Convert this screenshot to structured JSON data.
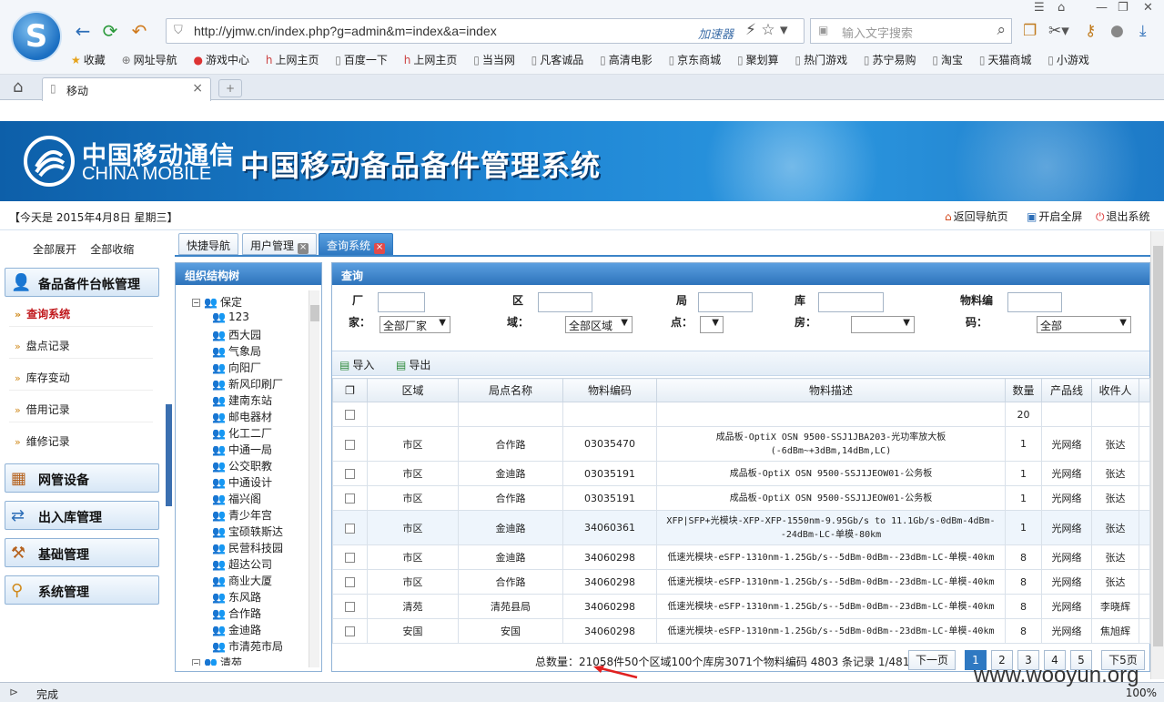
{
  "browser": {
    "url": "http://yjmw.cn/index.php?g=admin&m=index&a=index",
    "accelerator_label": "加速器",
    "search_placeholder": "输入文字搜索",
    "tab_title": "移动",
    "new_tab": "+",
    "status": "完成",
    "zoom": "100%",
    "bookmarks": [
      "收藏",
      "网址导航",
      "游戏中心",
      "上网主页",
      "百度一下",
      "上网主页",
      "当当网",
      "凡客诚品",
      "高清电影",
      "京东商城",
      "聚划算",
      "热门游戏",
      "苏宁易购",
      "淘宝",
      "天猫商城",
      "小游戏"
    ]
  },
  "header": {
    "company_cn": "中国移动通信",
    "company_en": "CHINA MOBILE",
    "system_title": "中国移动备品备件管理系统",
    "date_text": "【今天是 2015年4月8日 星期三】",
    "links": [
      "返回导航页",
      "开启全屏",
      "退出系统"
    ]
  },
  "left_menu": {
    "expand_all": "全部展开",
    "collapse_all": "全部收缩",
    "sections": [
      {
        "label": "备品备件台帐管理",
        "items": [
          {
            "label": "查询系统",
            "active": true
          },
          {
            "label": "盘点记录",
            "active": false
          },
          {
            "label": "库存变动",
            "active": false
          },
          {
            "label": "借用记录",
            "active": false
          },
          {
            "label": "维修记录",
            "active": false
          }
        ]
      },
      {
        "label": "网管设备",
        "items": []
      },
      {
        "label": "出入库管理",
        "items": []
      },
      {
        "label": "基础管理",
        "items": []
      },
      {
        "label": "系统管理",
        "items": []
      }
    ]
  },
  "tabs": [
    "快捷导航",
    "用户管理",
    "查询系统"
  ],
  "org_panel": {
    "title": "组织结构树",
    "root": "保定",
    "children": [
      "123",
      "西大园",
      "气象局",
      "向阳厂",
      "新风印刷厂",
      "建南东站",
      "邮电器材",
      "化工二厂",
      "中通一局",
      "公交职教",
      "中通设计",
      "福兴阁",
      "青少年宫",
      "宝硕轶斯达",
      "民营科技园",
      "超达公司",
      "商业大厦",
      "东风路",
      "合作路",
      "金迪路",
      "市清苑市局"
    ],
    "next_root": "清苑"
  },
  "query": {
    "title": "查询",
    "fields": {
      "factory_label_top": "厂",
      "factory_label_bottom": "家：",
      "factory_value": "全部厂家",
      "region_label_top": "区",
      "region_label_bottom": "域：",
      "region_value": "全部区域",
      "site_label_top": "局",
      "site_label_bottom": "点：",
      "room_label_top": "库",
      "room_label_bottom": "房：",
      "material_label_top": "物料编",
      "material_label_bottom": "码：",
      "material_value": "全部"
    },
    "import_label": "导入",
    "export_label": "导出"
  },
  "table": {
    "headers": [
      "区域",
      "局点名称",
      "物料编码",
      "物料描述",
      "数量",
      "产品线",
      "收件人"
    ],
    "rows": [
      [
        "",
        "",
        "",
        "",
        "20",
        "",
        ""
      ],
      [
        "市区",
        "合作路",
        "03035470",
        "成品板-OptiX OSN 9500-SSJ1JBA203-光功率放大板(-6dBm~+3dBm,14dBm,LC)",
        "1",
        "光网络",
        "张达"
      ],
      [
        "市区",
        "金迪路",
        "03035191",
        "成品板-OptiX OSN 9500-SSJ1JEOW01-公务板",
        "1",
        "光网络",
        "张达"
      ],
      [
        "市区",
        "合作路",
        "03035191",
        "成品板-OptiX OSN 9500-SSJ1JEOW01-公务板",
        "1",
        "光网络",
        "张达"
      ],
      [
        "市区",
        "金迪路",
        "34060361",
        "XFP|SFP+光模块-XFP-XFP-1550nm-9.95Gb/s to 11.1Gb/s-0dBm-4dBm--24dBm-LC-单模-80km",
        "1",
        "光网络",
        "张达"
      ],
      [
        "市区",
        "金迪路",
        "34060298",
        "低速光模块-eSFP-1310nm-1.25Gb/s--5dBm-0dBm--23dBm-LC-单模-40km",
        "8",
        "光网络",
        "张达"
      ],
      [
        "市区",
        "合作路",
        "34060298",
        "低速光模块-eSFP-1310nm-1.25Gb/s--5dBm-0dBm--23dBm-LC-单模-40km",
        "8",
        "光网络",
        "张达"
      ],
      [
        "清苑",
        "清苑县局",
        "34060298",
        "低速光模块-eSFP-1310nm-1.25Gb/s--5dBm-0dBm--23dBm-LC-单模-40km",
        "8",
        "光网络",
        "李晓辉"
      ],
      [
        "安国",
        "安国",
        "34060298",
        "低速光模块-eSFP-1310nm-1.25Gb/s--5dBm-0dBm--23dBm-LC-单模-40km",
        "8",
        "光网络",
        "焦旭辉"
      ]
    ]
  },
  "pager": {
    "summary": "总数量：21058件50个区域100个库房3071个物料编码 4803 条记录 1/481 页",
    "prev": "下一页",
    "pages": [
      "1",
      "2",
      "3",
      "4",
      "5"
    ],
    "next": "下5页"
  },
  "watermark": "www.wooyun.org",
  "colors": {
    "accent": "#2f79c2",
    "banner": "#1f86d4",
    "active_menu": "#c0171b"
  }
}
